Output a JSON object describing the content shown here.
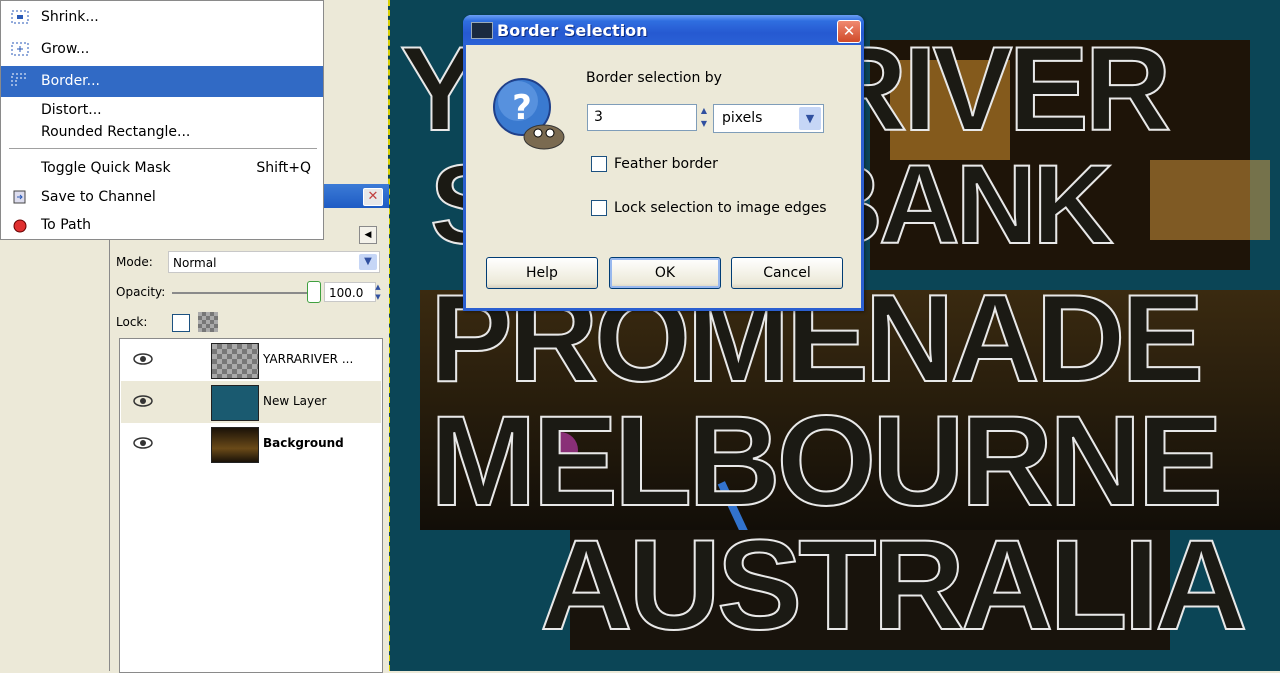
{
  "menu": {
    "items": [
      {
        "label": "Shrink...",
        "icon": "shrink-icon"
      },
      {
        "label": "Grow...",
        "icon": "grow-icon"
      },
      {
        "label": "Border...",
        "icon": "border-icon",
        "highlighted": true
      },
      {
        "label": "Distort..."
      },
      {
        "label": "Rounded Rectangle..."
      },
      {
        "label": "Toggle Quick Mask",
        "shortcut": "Shift+Q"
      },
      {
        "label": "Save to Channel",
        "icon": "save-to-channel-icon"
      },
      {
        "label": "To Path",
        "icon": "to-path-icon"
      }
    ]
  },
  "layers": {
    "mode_label": "Mode:",
    "mode_value": "Normal",
    "opacity_label": "Opacity:",
    "opacity_value": "100.0",
    "opacity_fraction": 1.0,
    "lock_label": "Lock:",
    "rows": [
      {
        "name": "YARRARIVER ...",
        "bold": false,
        "selected": false
      },
      {
        "name": "New Layer",
        "bold": false,
        "selected": true
      },
      {
        "name": "Background",
        "bold": true,
        "selected": false
      }
    ]
  },
  "dialog": {
    "title": "Border Selection",
    "border_by_label": "Border selection by",
    "border_value": "3",
    "unit": "pixels",
    "feather_label": "Feather border",
    "feather_checked": false,
    "lock_edges_label": "Lock selection to image edges",
    "lock_edges_checked": false,
    "help_button": "Help",
    "ok_button": "OK",
    "cancel_button": "Cancel"
  },
  "canvas": {
    "lines": [
      "YARRA RIVER",
      "SOUTHBANK",
      "PROMENADE",
      "MELBOURNE",
      "AUSTRALIA"
    ],
    "background_color": "#0b4556"
  },
  "colors": {
    "selection_highlight": "#316ac5",
    "title_bar": "#2659d1"
  }
}
